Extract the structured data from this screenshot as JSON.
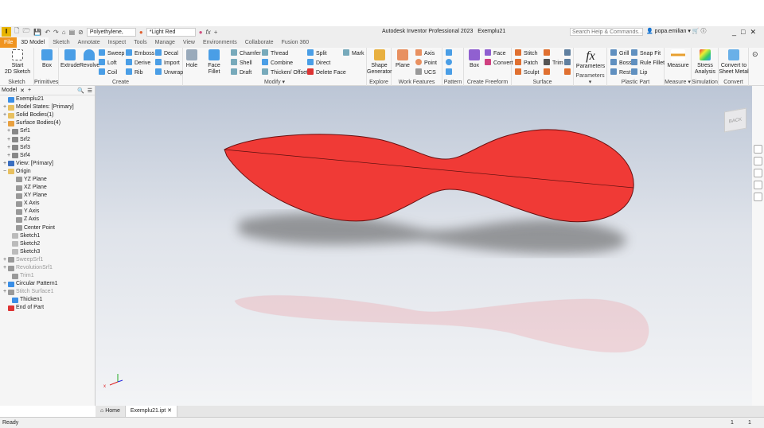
{
  "app": {
    "title": "Autodesk Inventor Professional 2023",
    "document": "Exemplu21",
    "logo": "I"
  },
  "qat": {
    "material": "Polyethylene,",
    "appearance": "*Light Red",
    "fx": "fx"
  },
  "search": {
    "placeholder": "Search Help & Commands..."
  },
  "user": {
    "name": "popa.emilian"
  },
  "tabs": [
    "File",
    "3D Model",
    "Sketch",
    "Annotate",
    "Inspect",
    "Tools",
    "Manage",
    "View",
    "Environments",
    "Collaborate",
    "Fusion 360"
  ],
  "ribbon": {
    "sketch": {
      "label": "Sketch",
      "start": "Start",
      "start2": "2D Sketch"
    },
    "primitives": {
      "label": "Primitives",
      "box": "Box"
    },
    "create": {
      "label": "Create",
      "extrude": "Extrude",
      "revolve": "Revolve",
      "sweep": "Sweep",
      "loft": "Loft",
      "coil": "Coil",
      "emboss": "Emboss",
      "derive": "Derive",
      "rib": "Rib",
      "decal": "Decal",
      "import": "Import",
      "unwrap": "Unwrap"
    },
    "modify": {
      "label": "Modify",
      "hole": "Hole",
      "face_fillet": "Face Fillet",
      "chamfer": "Chamfer",
      "shell": "Shell",
      "draft": "Draft",
      "thread": "Thread",
      "combine": "Combine",
      "thicken": "Thicken/ Offset",
      "split": "Split",
      "direct": "Direct",
      "delete_face": "Delete Face",
      "mark": "Mark"
    },
    "explore": {
      "label": "Explore",
      "shape": "Shape",
      "shape2": "Generator"
    },
    "work": {
      "label": "Work Features",
      "plane": "Plane",
      "axis": "Axis",
      "point": "Point",
      "ucs": "UCS"
    },
    "pattern": {
      "label": "Pattern"
    },
    "freeform": {
      "label": "Create Freeform",
      "box": "Box",
      "face": "Face",
      "convert": "Convert"
    },
    "surface": {
      "label": "Surface",
      "stitch": "Stitch",
      "patch": "Patch",
      "sculpt": "Sculpt",
      "trim": "Trim"
    },
    "parameters": {
      "label": "Parameters",
      "btn": "Parameters"
    },
    "plastic": {
      "label": "Plastic Part",
      "grill": "Grill",
      "boss": "Boss",
      "rest": "Rest",
      "snap": "Snap Fit",
      "rule": "Rule Fillet",
      "lip": "Lip"
    },
    "measure": {
      "label": "Measure",
      "btn": "Measure"
    },
    "simulation": {
      "label": "Simulation",
      "btn": "Stress",
      "btn2": "Analysis"
    },
    "convert": {
      "label": "Convert",
      "btn": "Convert to",
      "btn2": "Sheet Metal"
    }
  },
  "browser": {
    "tab": "Model",
    "items": [
      {
        "label": "Exemplu21",
        "lvl": 0,
        "pm": "",
        "c": "#3a8ee6"
      },
      {
        "label": "Model States: [Primary]",
        "lvl": 0,
        "pm": "+",
        "c": "#e8c060"
      },
      {
        "label": "Solid Bodies(1)",
        "lvl": 0,
        "pm": "+",
        "c": "#e8c060"
      },
      {
        "label": "Surface Bodies(4)",
        "lvl": 0,
        "pm": "−",
        "c": "#e8a040"
      },
      {
        "label": "Srf1",
        "lvl": 1,
        "pm": "+",
        "c": "#888"
      },
      {
        "label": "Srf2",
        "lvl": 1,
        "pm": "+",
        "c": "#888"
      },
      {
        "label": "Srf3",
        "lvl": 1,
        "pm": "+",
        "c": "#888"
      },
      {
        "label": "Srf4",
        "lvl": 1,
        "pm": "+",
        "c": "#888"
      },
      {
        "label": "View: [Primary]",
        "lvl": 0,
        "pm": "+",
        "c": "#3a6ec0"
      },
      {
        "label": "Origin",
        "lvl": 0,
        "pm": "−",
        "c": "#e8c060"
      },
      {
        "label": "YZ Plane",
        "lvl": 2,
        "pm": "",
        "c": "#999"
      },
      {
        "label": "XZ Plane",
        "lvl": 2,
        "pm": "",
        "c": "#999"
      },
      {
        "label": "XY Plane",
        "lvl": 2,
        "pm": "",
        "c": "#999"
      },
      {
        "label": "X Axis",
        "lvl": 2,
        "pm": "",
        "c": "#999"
      },
      {
        "label": "Y Axis",
        "lvl": 2,
        "pm": "",
        "c": "#999"
      },
      {
        "label": "Z Axis",
        "lvl": 2,
        "pm": "",
        "c": "#999"
      },
      {
        "label": "Center Point",
        "lvl": 2,
        "pm": "",
        "c": "#999"
      },
      {
        "label": "Sketch1",
        "lvl": 1,
        "pm": "",
        "c": "#bbb"
      },
      {
        "label": "Sketch2",
        "lvl": 1,
        "pm": "",
        "c": "#bbb"
      },
      {
        "label": "Sketch3",
        "lvl": 1,
        "pm": "",
        "c": "#bbb"
      },
      {
        "label": "SweepSrf1",
        "lvl": 0,
        "pm": "+",
        "c": "#999",
        "dim": true
      },
      {
        "label": "RevolutionSrf1",
        "lvl": 0,
        "pm": "+",
        "c": "#999",
        "dim": true
      },
      {
        "label": "Trim1",
        "lvl": 1,
        "pm": "",
        "c": "#999",
        "dim": true
      },
      {
        "label": "Circular Pattern1",
        "lvl": 0,
        "pm": "+",
        "c": "#3a8ee6"
      },
      {
        "label": "Stitch Surface1",
        "lvl": 0,
        "pm": "+",
        "c": "#999",
        "dim": true
      },
      {
        "label": "Thicken1",
        "lvl": 1,
        "pm": "",
        "c": "#3a8ee6"
      },
      {
        "label": "End of Part",
        "lvl": 0,
        "pm": "",
        "c": "#d33"
      }
    ]
  },
  "viewcube": {
    "face": "BACK"
  },
  "doc_tabs": [
    "Home",
    "Exemplu21.ipt"
  ],
  "status": {
    "text": "Ready",
    "n1": "1",
    "n2": "1"
  },
  "colors": {
    "model": "#f03a36",
    "file_tab": "#f0941f"
  }
}
